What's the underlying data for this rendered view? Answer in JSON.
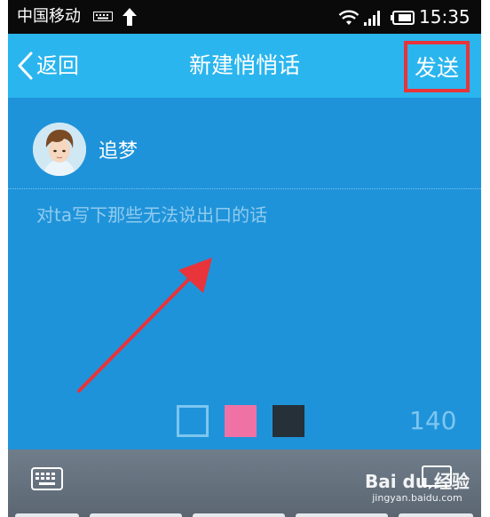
{
  "status_bar": {
    "carrier": "中国移动",
    "time": "15:35",
    "icons": [
      "keyboard-icon",
      "upload-arrow-icon",
      "wifi-icon",
      "signal-icon",
      "battery-icon"
    ]
  },
  "nav": {
    "back_label": "返回",
    "title": "新建悄悄话",
    "send_label": "发送"
  },
  "recipient": {
    "name": "追梦"
  },
  "message": {
    "placeholder": "对ta写下那些无法说出口的话",
    "value": ""
  },
  "colors": {
    "nav_bg": "#2ab5ee",
    "content_bg": "#1f93d9",
    "highlight_border": "#e8343a",
    "swatch_outline": "#7cc6f0",
    "swatch_pink": "#f072a4",
    "swatch_dark": "#263039",
    "annotation_arrow": "#e8343a"
  },
  "swatches": [
    {
      "name": "outline",
      "color": "#7cc6f0"
    },
    {
      "name": "pink",
      "color": "#f072a4"
    },
    {
      "name": "dark",
      "color": "#263039"
    }
  ],
  "counter": {
    "remaining": "140"
  },
  "keyboard_toolbar": {
    "icons": [
      "keyboard-toggle-icon",
      "emoticon-icon"
    ]
  },
  "watermark": {
    "logo": "Bai du 经验",
    "url": "jingyan.baidu.com"
  }
}
